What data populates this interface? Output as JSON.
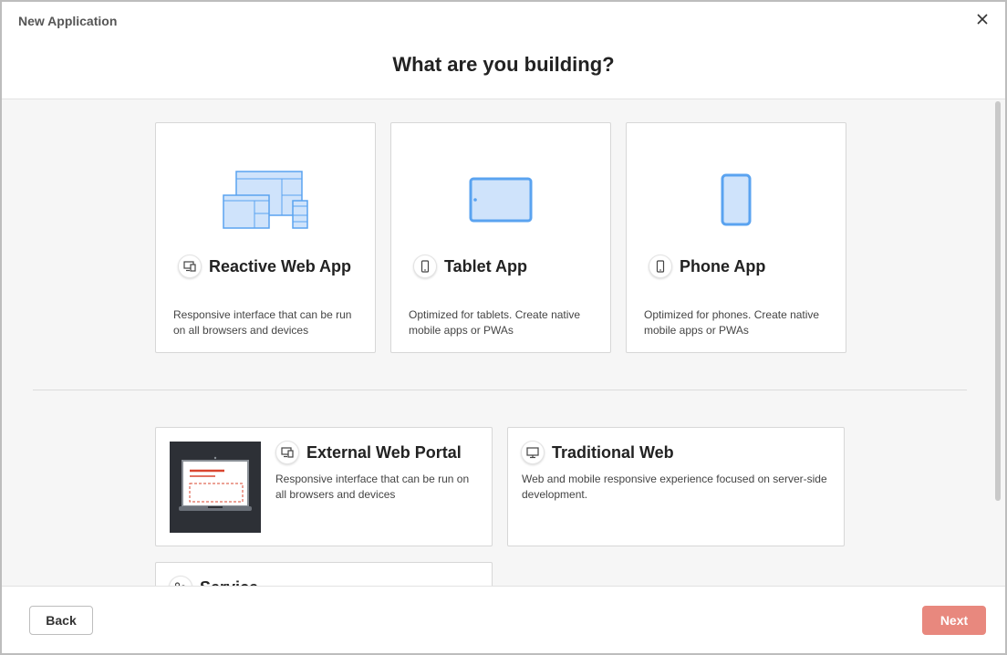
{
  "dialog": {
    "title": "New Application"
  },
  "heading": "What are you building?",
  "cards": [
    {
      "id": "reactive",
      "title": "Reactive Web App",
      "description": "Responsive interface that can be run on all browsers and devices",
      "icon": "devices-icon"
    },
    {
      "id": "tablet",
      "title": "Tablet App",
      "description": "Optimized for tablets. Create native mobile apps or PWAs",
      "icon": "phone-icon"
    },
    {
      "id": "phone",
      "title": "Phone App",
      "description": "Optimized for phones. Create native mobile apps or PWAs",
      "icon": "phone-icon"
    }
  ],
  "secondary_cards": [
    {
      "id": "portal",
      "title": "External Web Portal",
      "description": "Responsive interface that can be run on all browsers and devices",
      "icon": "devices-icon"
    },
    {
      "id": "traditional",
      "title": "Traditional Web",
      "description": "Web and mobile responsive experience focused on server-side development.",
      "icon": "monitor-icon"
    },
    {
      "id": "service",
      "title": "Service",
      "icon": "service-icon"
    }
  ],
  "footer": {
    "back_label": "Back",
    "next_label": "Next"
  },
  "colors": {
    "accent_blue": "#5aa3f0",
    "light_blue": "#cfe3fb",
    "next_button": "#e8887e",
    "portal_red": "#d9452f"
  }
}
